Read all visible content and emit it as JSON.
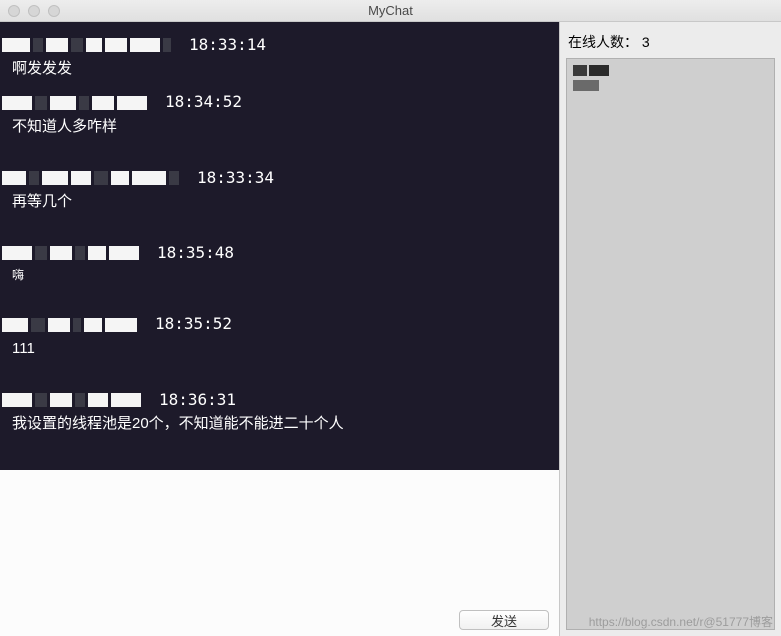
{
  "window": {
    "title": "MyChat"
  },
  "messages": [
    {
      "time": "18:33:14",
      "text": "啊发发发",
      "small": false
    },
    {
      "time": "18:34:52",
      "text": "不知道人多咋样",
      "small": false
    },
    {
      "time": "18:33:34",
      "text": "再等几个",
      "small": false
    },
    {
      "time": "18:35:48",
      "text": "嗨",
      "small": true
    },
    {
      "time": "18:35:52",
      "text": "111",
      "small": false
    },
    {
      "time": "18:36:31",
      "text": "我设置的线程池是20个，不知道能不能进二十个人",
      "small": false
    }
  ],
  "sidebar": {
    "online_label": "在线人数：",
    "online_count": "3"
  },
  "buttons": {
    "send": "发送"
  },
  "watermark": "https://blog.csdn.net/r@51777博客"
}
